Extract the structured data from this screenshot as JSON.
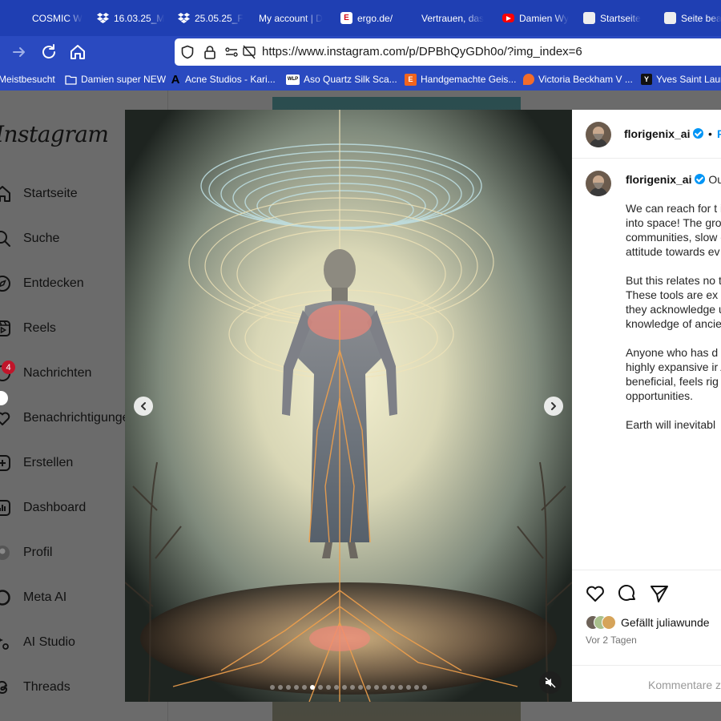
{
  "browser": {
    "tabs": [
      {
        "label": "COSMIC W",
        "icon": "blank-icon"
      },
      {
        "label": "16.03.25_M",
        "icon": "dropbox-icon"
      },
      {
        "label": "25.05.25_F",
        "icon": "dropbox-icon"
      },
      {
        "label": "My account | D",
        "icon": "blank-icon"
      },
      {
        "label": "ergo.de/",
        "icon": "ergo-icon"
      },
      {
        "label": "Vertrauen, das",
        "icon": "blank-icon"
      },
      {
        "label": "Damien Wy",
        "icon": "youtube-icon"
      },
      {
        "label": "Startseite",
        "icon": "site-icon"
      },
      {
        "label": "Seite bea",
        "icon": "site-icon"
      }
    ],
    "url": "https://www.instagram.com/p/DPBhQyGDh0o/?img_index=6",
    "bookmarks": [
      {
        "label": "Meistbesucht",
        "icon": "none"
      },
      {
        "label": "Damien super NEW",
        "icon": "folder-icon"
      },
      {
        "label": "Acne Studios - Kari...",
        "icon": "acne-icon"
      },
      {
        "label": "Aso Quartz Silk Sca...",
        "icon": "wlp-icon"
      },
      {
        "label": "Handgemachte Geis...",
        "icon": "etsy-icon"
      },
      {
        "label": "Victoria Beckham V ...",
        "icon": "vb-icon"
      },
      {
        "label": "Yves Saint Laur",
        "icon": "ysl-icon"
      }
    ]
  },
  "sidebar": {
    "logo": "Instagram",
    "items": [
      {
        "label": "Startseite",
        "icon": "home-icon"
      },
      {
        "label": "Suche",
        "icon": "search-icon"
      },
      {
        "label": "Entdecken",
        "icon": "compass-icon"
      },
      {
        "label": "Reels",
        "icon": "reels-icon"
      },
      {
        "label": "Nachrichten",
        "icon": "messenger-icon"
      },
      {
        "label": "Benachrichtigungen",
        "icon": "heart-icon"
      },
      {
        "label": "Erstellen",
        "icon": "plus-icon"
      },
      {
        "label": "Dashboard",
        "icon": "dashboard-icon"
      },
      {
        "label": "Profil",
        "icon": "profile-icon"
      },
      {
        "label": "Meta AI",
        "icon": "meta-ai-icon"
      },
      {
        "label": "AI Studio",
        "icon": "ai-studio-icon"
      },
      {
        "label": "Threads",
        "icon": "threads-icon"
      }
    ],
    "messages_badge": "4"
  },
  "post": {
    "username": "florigenix_ai",
    "follow_label": "F",
    "carousel": {
      "total": 20,
      "active_index": 5
    },
    "caption": [
      "Our our roots grow dee",
      "We can reach for t if our foundations off into space! The grounding in natur communities, slow exercises and emb attitude towards ev",
      "But this relates no to the collective ar These tools are ex Earth, and they be they acknowledge unseen forces sup knowledge of ancie",
      "Anyone who has d amplifies what you highly expansive ir Aim these intellige beneficial, feels rig they will enhance a opportunities.",
      "Earth will inevitabl"
    ],
    "likes_text": "Gefällt juliawunde",
    "time_ago": "Vor 2 Tagen",
    "comment_placeholder": "Kommentare z"
  },
  "colors": {
    "tabbar": "#1f3fb3",
    "navbar": "#2a4ac0",
    "verified": "#0095f6",
    "badge": "#c0152a"
  }
}
